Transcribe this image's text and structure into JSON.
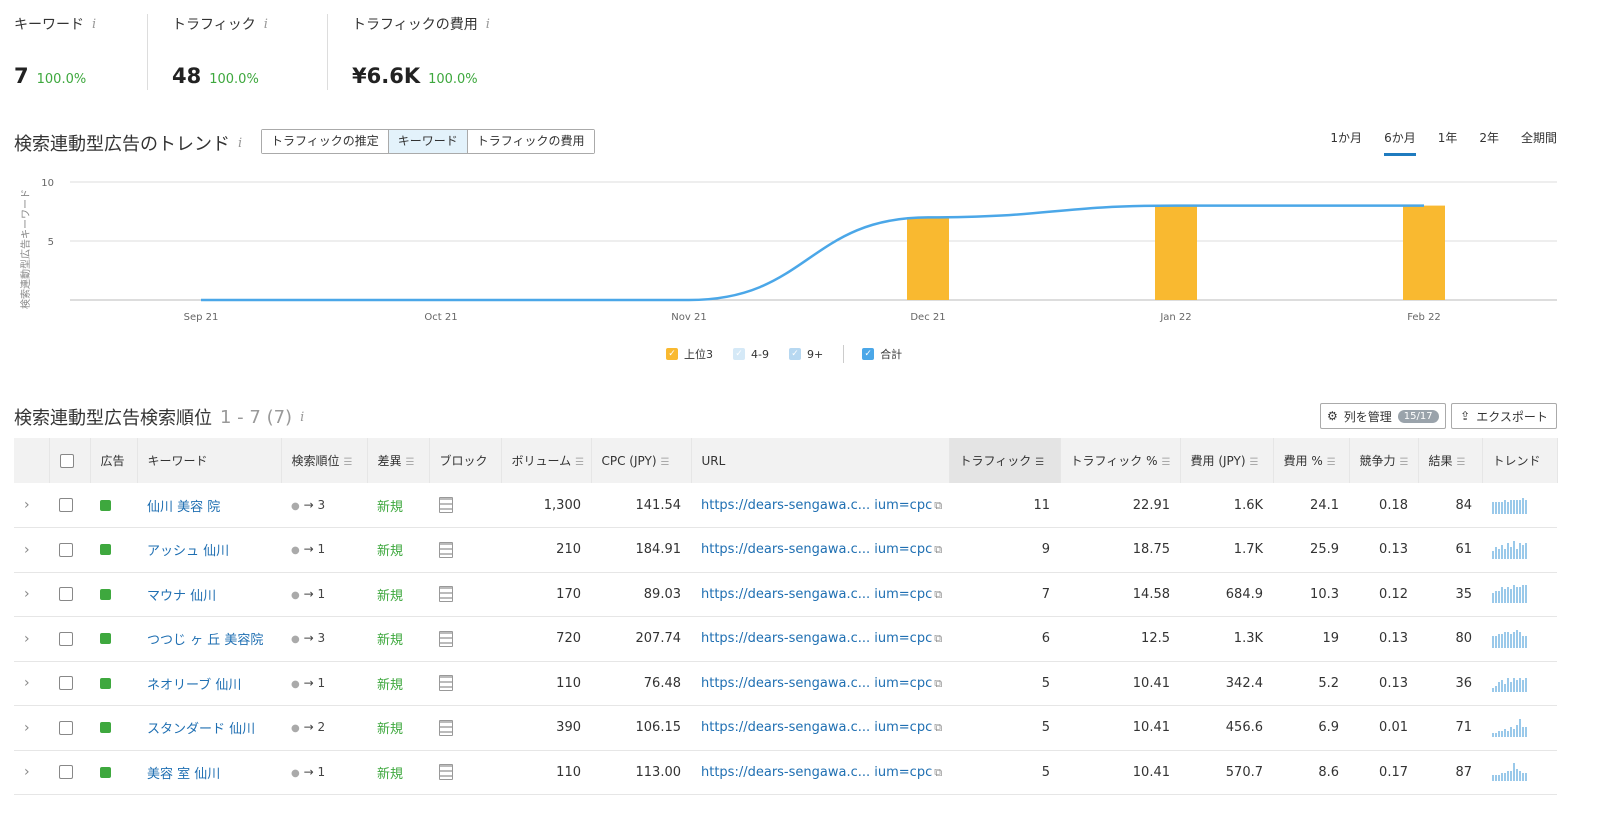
{
  "metrics": [
    {
      "label": "キーワード",
      "value": "7",
      "pct": "100.0%"
    },
    {
      "label": "トラフィック",
      "value": "48",
      "pct": "100.0%"
    },
    {
      "label": "トラフィックの費用",
      "value": "¥6.6K",
      "pct": "100.0%"
    }
  ],
  "info_icon": "i",
  "trend": {
    "title": "検索連動型広告のトレンド",
    "tabs": [
      "トラフィックの推定",
      "キーワード",
      "トラフィックの費用"
    ],
    "active_tab": 1,
    "ranges": [
      "1か月",
      "6か月",
      "1年",
      "2年",
      "全期間"
    ],
    "active_range": 1
  },
  "chart_data": {
    "type": "bar",
    "ylabel": "検索連動型広告キーワード",
    "ylim": [
      0,
      10
    ],
    "yticks": [
      "10",
      "5"
    ],
    "categories": [
      "Sep 21",
      "Oct 21",
      "Nov 21",
      "Dec 21",
      "Jan 22",
      "Feb 22"
    ],
    "series": [
      {
        "name": "上位3",
        "values": [
          0,
          0,
          0,
          7,
          8,
          8
        ],
        "color": "#f9b930"
      },
      {
        "name": "4-9",
        "values": [
          0,
          0,
          0,
          0,
          0,
          0
        ],
        "color": "#d5e9f7"
      },
      {
        "name": "9+",
        "values": [
          0,
          0,
          0,
          0,
          0,
          0
        ],
        "color": "#b7d8f1"
      },
      {
        "name": "合計",
        "values": [
          0,
          0,
          0,
          7,
          8,
          8
        ],
        "color": "#4ba7e8"
      }
    ]
  },
  "table": {
    "title": "検索連動型広告検索順位",
    "range_text": "1 - 7 (7)",
    "manage_label": "列を管理",
    "manage_badge": "15/17",
    "export_label": "エクスポート",
    "headers": [
      "広告",
      "キーワード",
      "検索順位",
      "差異",
      "ブロック",
      "ボリューム",
      "CPC (JPY)",
      "URL",
      "トラフィック",
      "トラフィック %",
      "費用 (JPY)",
      "費用 %",
      "競争力",
      "結果",
      "トレンド"
    ],
    "rows": [
      {
        "keyword": "仙川 美容 院",
        "pos": "3",
        "diff": "新規",
        "volume": "1,300",
        "cpc": "141.54",
        "url": "https://dears-sengawa.c...  ium=cpc",
        "traffic": "11",
        "traffic_pct": "22.91",
        "cost": "1.6K",
        "cost_pct": "24.1",
        "comp": "0.18",
        "results": "84",
        "trend": [
          6,
          6,
          6,
          6,
          7,
          6,
          7,
          7,
          7,
          7,
          8,
          7
        ]
      },
      {
        "keyword": "アッシュ 仙川",
        "pos": "1",
        "diff": "新規",
        "volume": "210",
        "cpc": "184.91",
        "url": "https://dears-sengawa.c...  ium=cpc",
        "traffic": "9",
        "traffic_pct": "18.75",
        "cost": "1.7K",
        "cost_pct": "25.9",
        "comp": "0.13",
        "results": "61",
        "trend": [
          4,
          6,
          5,
          7,
          5,
          8,
          6,
          9,
          5,
          8,
          7,
          8
        ]
      },
      {
        "keyword": "マウナ 仙川",
        "pos": "1",
        "diff": "新規",
        "volume": "170",
        "cpc": "89.03",
        "url": "https://dears-sengawa.c...  ium=cpc",
        "traffic": "7",
        "traffic_pct": "14.58",
        "cost": "684.9",
        "cost_pct": "10.3",
        "comp": "0.12",
        "results": "35",
        "trend": [
          5,
          6,
          6,
          8,
          7,
          8,
          7,
          9,
          8,
          8,
          9,
          9
        ]
      },
      {
        "keyword": "つつじ ヶ 丘 美容院",
        "pos": "3",
        "diff": "新規",
        "volume": "720",
        "cpc": "207.74",
        "url": "https://dears-sengawa.c...  ium=cpc",
        "traffic": "6",
        "traffic_pct": "12.5",
        "cost": "1.3K",
        "cost_pct": "19",
        "comp": "0.13",
        "results": "80",
        "trend": [
          6,
          6,
          7,
          7,
          8,
          8,
          7,
          8,
          9,
          8,
          6,
          6
        ]
      },
      {
        "keyword": "ネオリーブ 仙川",
        "pos": "1",
        "diff": "新規",
        "volume": "110",
        "cpc": "76.48",
        "url": "https://dears-sengawa.c...  ium=cpc",
        "traffic": "5",
        "traffic_pct": "10.41",
        "cost": "342.4",
        "cost_pct": "5.2",
        "comp": "0.13",
        "results": "36",
        "trend": [
          2,
          3,
          5,
          6,
          4,
          7,
          5,
          7,
          6,
          7,
          6,
          7
        ]
      },
      {
        "keyword": "スタンダード 仙川",
        "pos": "2",
        "diff": "新規",
        "volume": "390",
        "cpc": "106.15",
        "url": "https://dears-sengawa.c...  ium=cpc",
        "traffic": "5",
        "traffic_pct": "10.41",
        "cost": "456.6",
        "cost_pct": "6.9",
        "comp": "0.01",
        "results": "71",
        "trend": [
          2,
          2,
          3,
          3,
          4,
          3,
          5,
          4,
          6,
          9,
          5,
          5
        ]
      },
      {
        "keyword": "美容 室 仙川",
        "pos": "1",
        "diff": "新規",
        "volume": "110",
        "cpc": "113.00",
        "url": "https://dears-sengawa.c...  ium=cpc",
        "traffic": "5",
        "traffic_pct": "10.41",
        "cost": "570.7",
        "cost_pct": "8.6",
        "comp": "0.17",
        "results": "87",
        "trend": [
          3,
          3,
          3,
          4,
          4,
          5,
          5,
          9,
          6,
          5,
          4,
          4
        ]
      }
    ]
  }
}
